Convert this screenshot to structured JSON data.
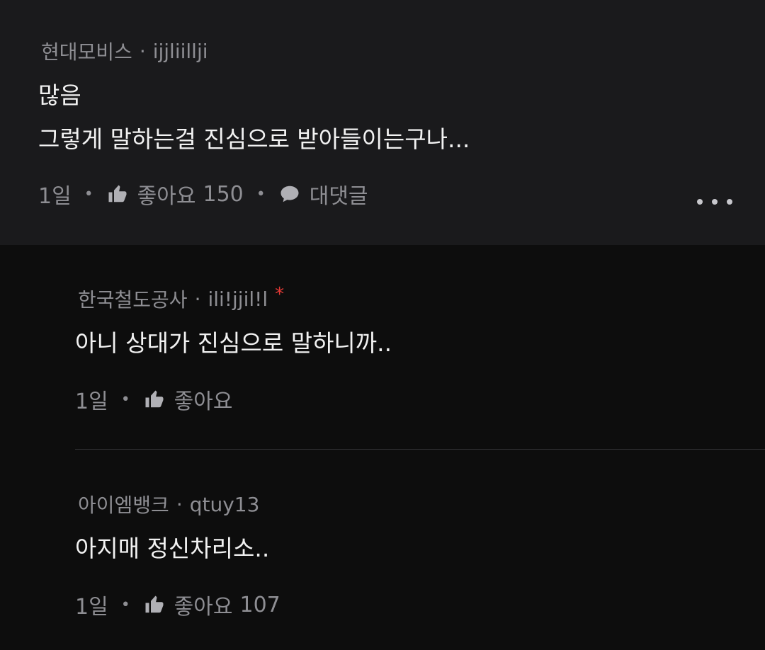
{
  "comment": {
    "company": "현대모비스",
    "username": "ijjliilljі",
    "lines": [
      "많음",
      "그렇게 말하는걸 진심으로 받아들이는구나..."
    ],
    "time": "1일",
    "like_label": "좋아요",
    "like_count": "150",
    "reply_label": "대댓글",
    "more_icon": "more-horizontal-icon"
  },
  "replies": [
    {
      "company": "한국철도공사",
      "username": "ili!jjil!l",
      "author_marker": "*",
      "text": "아니 상대가 진심으로 말하니까..",
      "time": "1일",
      "like_label": "좋아요",
      "like_count": ""
    },
    {
      "company": "아이엠뱅크",
      "username": "qtuy13",
      "text": "아지매 정신차리소..",
      "time": "1일",
      "like_label": "좋아요",
      "like_count": "107"
    }
  ],
  "icons": {
    "like": "thumbs-up-icon",
    "reply": "speech-bubble-icon"
  },
  "colors": {
    "background_top": "#1a1a1c",
    "background": "#0d0d0d",
    "text": "#f2f2f2",
    "muted": "#8e8e93",
    "marker": "#e53935"
  }
}
